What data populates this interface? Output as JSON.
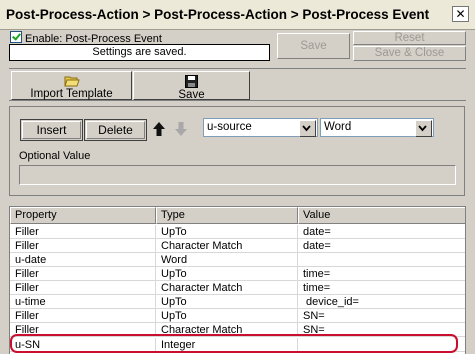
{
  "window": {
    "title": "Post-Process-Action > Post-Process-Action > Post-Process Event"
  },
  "top": {
    "enable_label": "Enable: Post-Process Event",
    "status_text": "Settings are saved.",
    "save_label": "Save",
    "reset_label": "Reset",
    "save_close_label": "Save & Close"
  },
  "toolbar": {
    "import_label": "Import Template",
    "save_label": "Save"
  },
  "controls": {
    "insert_label": "Insert",
    "delete_label": "Delete",
    "source_value": "u-source",
    "type_value": "Word",
    "optional_label": "Optional Value"
  },
  "grid": {
    "columns": [
      "Property",
      "Type",
      "Value"
    ],
    "rows": [
      [
        "Filler",
        "UpTo",
        "date="
      ],
      [
        "Filler",
        "Character Match",
        "date="
      ],
      [
        "u-date",
        "Word",
        ""
      ],
      [
        "Filler",
        "UpTo",
        "time="
      ],
      [
        "Filler",
        "Character Match",
        "time="
      ],
      [
        "u-time",
        "UpTo",
        " device_id="
      ],
      [
        "Filler",
        "UpTo",
        "SN="
      ],
      [
        "Filler",
        "Character Match",
        "SN="
      ],
      [
        "u-SN",
        "Integer",
        ""
      ]
    ]
  },
  "colors": {
    "highlight": "#c8102e",
    "window_bg": "#d4d0c8"
  }
}
